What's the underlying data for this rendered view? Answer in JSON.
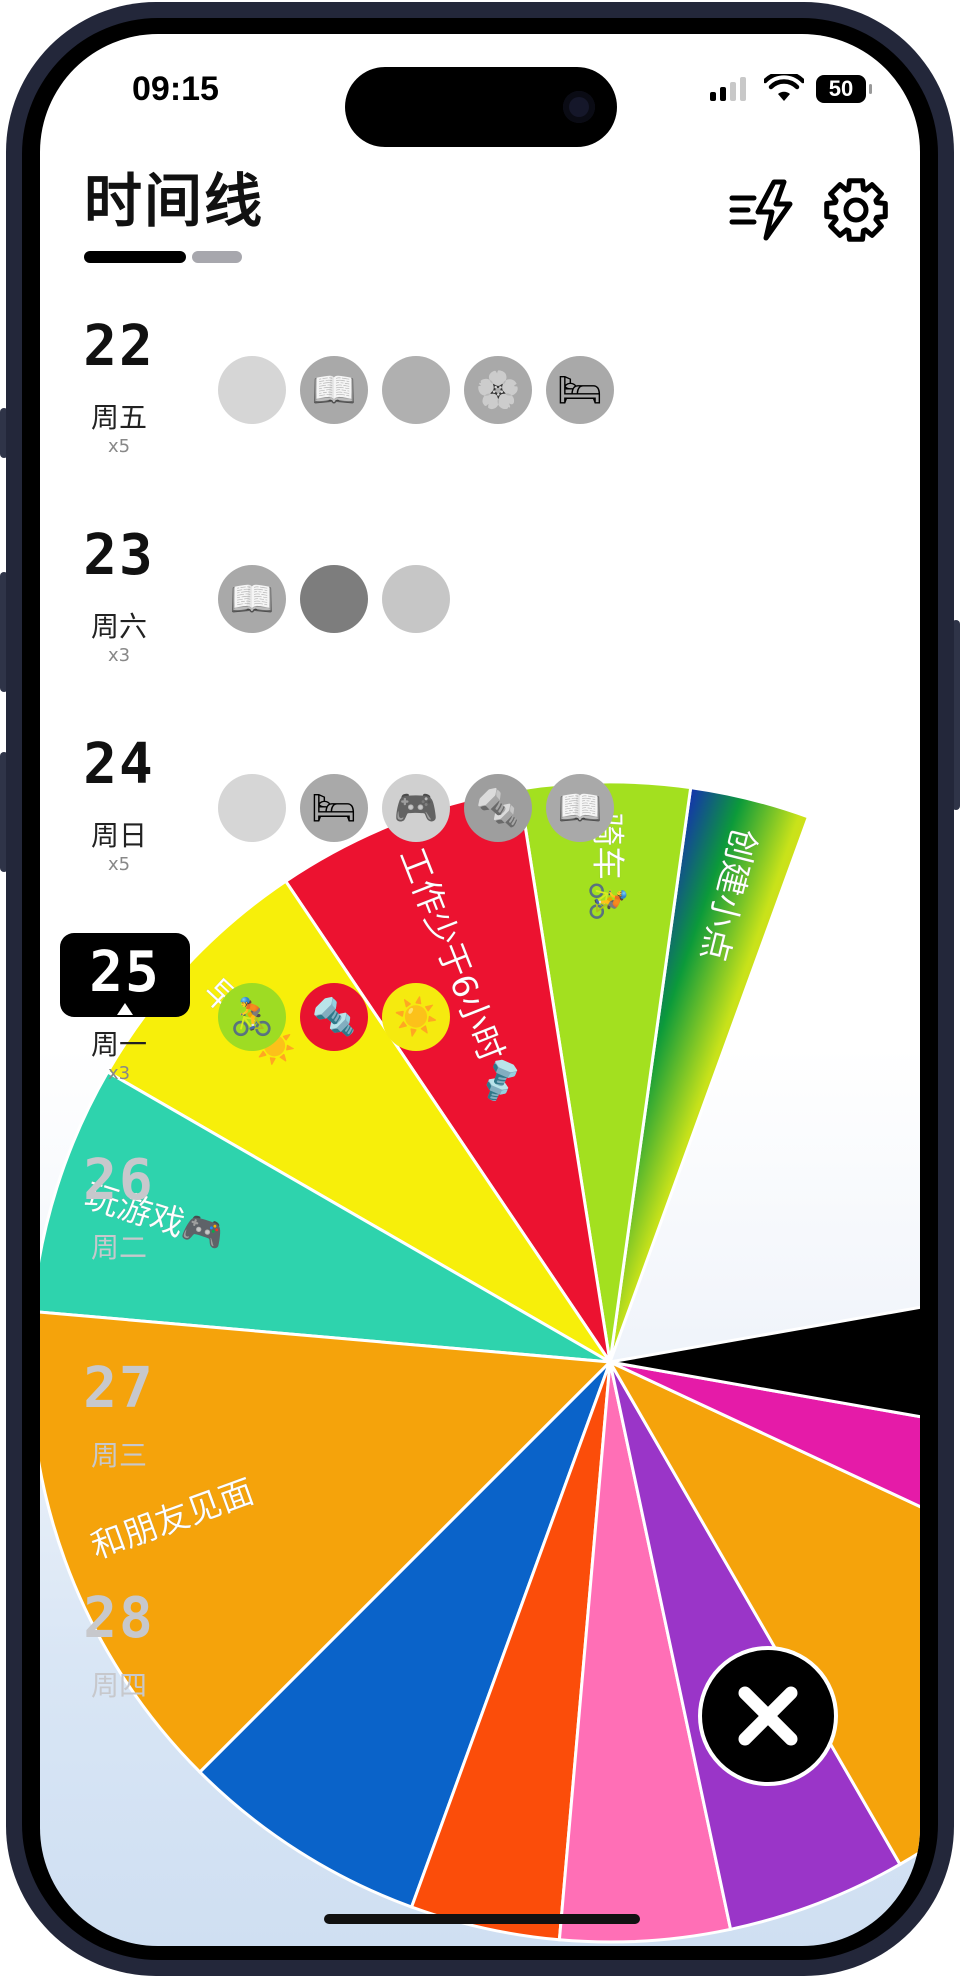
{
  "status": {
    "time": "09:15",
    "battery": "50"
  },
  "header": {
    "title": "时间线",
    "quick_icon": "quick-add-lightning-icon",
    "settings_icon": "gear-icon"
  },
  "days": [
    {
      "num": "22",
      "weekday": "周五",
      "count": "x5",
      "state": "past",
      "dots": [
        {
          "emoji": "",
          "color": "#d6d6d6"
        },
        {
          "emoji": "📖",
          "color": "#a9a9a9"
        },
        {
          "emoji": "",
          "color": "#b0b0b0"
        },
        {
          "emoji": "🌸",
          "color": "#a9a9a9"
        },
        {
          "emoji": "🛏",
          "color": "#a9a9a9"
        }
      ]
    },
    {
      "num": "23",
      "weekday": "周六",
      "count": "x3",
      "state": "past",
      "dots": [
        {
          "emoji": "📖",
          "color": "#a9a9a9"
        },
        {
          "emoji": "",
          "color": "#7d7d7d"
        },
        {
          "emoji": "",
          "color": "#c6c6c6"
        }
      ]
    },
    {
      "num": "24",
      "weekday": "周日",
      "count": "x5",
      "state": "past",
      "dots": [
        {
          "emoji": "",
          "color": "#d6d6d6"
        },
        {
          "emoji": "🛏",
          "color": "#a9a9a9"
        },
        {
          "emoji": "🎮",
          "color": "#d0d0d0"
        },
        {
          "emoji": "🔩",
          "color": "#9e9e9e"
        },
        {
          "emoji": "📖",
          "color": "#a9a9a9"
        }
      ]
    },
    {
      "num": "25",
      "weekday": "周一",
      "count": "x3",
      "state": "today",
      "dots": [
        {
          "emoji": "🚴",
          "color": "#9edc23"
        },
        {
          "emoji": "🔩",
          "color": "#e8132f"
        },
        {
          "emoji": "☀️",
          "color": "#f5ea0f"
        }
      ]
    },
    {
      "num": "26",
      "weekday": "周二",
      "count": "",
      "state": "future",
      "dots": []
    },
    {
      "num": "27",
      "weekday": "周三",
      "count": "",
      "state": "future",
      "dots": []
    },
    {
      "num": "28",
      "weekday": "周四",
      "count": "",
      "state": "future",
      "dots": []
    }
  ],
  "wheel": {
    "segments": [
      {
        "label": "创建小点",
        "color": "rainbow"
      },
      {
        "label": "骑车🚴",
        "color": "#a3e01f"
      },
      {
        "label": "工作少于6小时🔩",
        "color": "#ec1230"
      },
      {
        "label": "早起☀️",
        "color": "#f7ef0a"
      },
      {
        "label": "玩游戏🎮",
        "color": "#2ed3ad"
      },
      {
        "label": "和朋友见面",
        "color": "#f5a30b"
      },
      {
        "label": "",
        "color": "#0a63c9"
      },
      {
        "label": "",
        "color": "#fb4d0a"
      },
      {
        "label": "",
        "color": "#ff6fb6"
      },
      {
        "label": "",
        "color": "#9a35c8"
      },
      {
        "label": "",
        "color": "#f5a30b"
      },
      {
        "label": "",
        "color": "#e51ba8"
      },
      {
        "label": "",
        "color": "#000000"
      }
    ],
    "close_icon": "close-x-icon"
  }
}
